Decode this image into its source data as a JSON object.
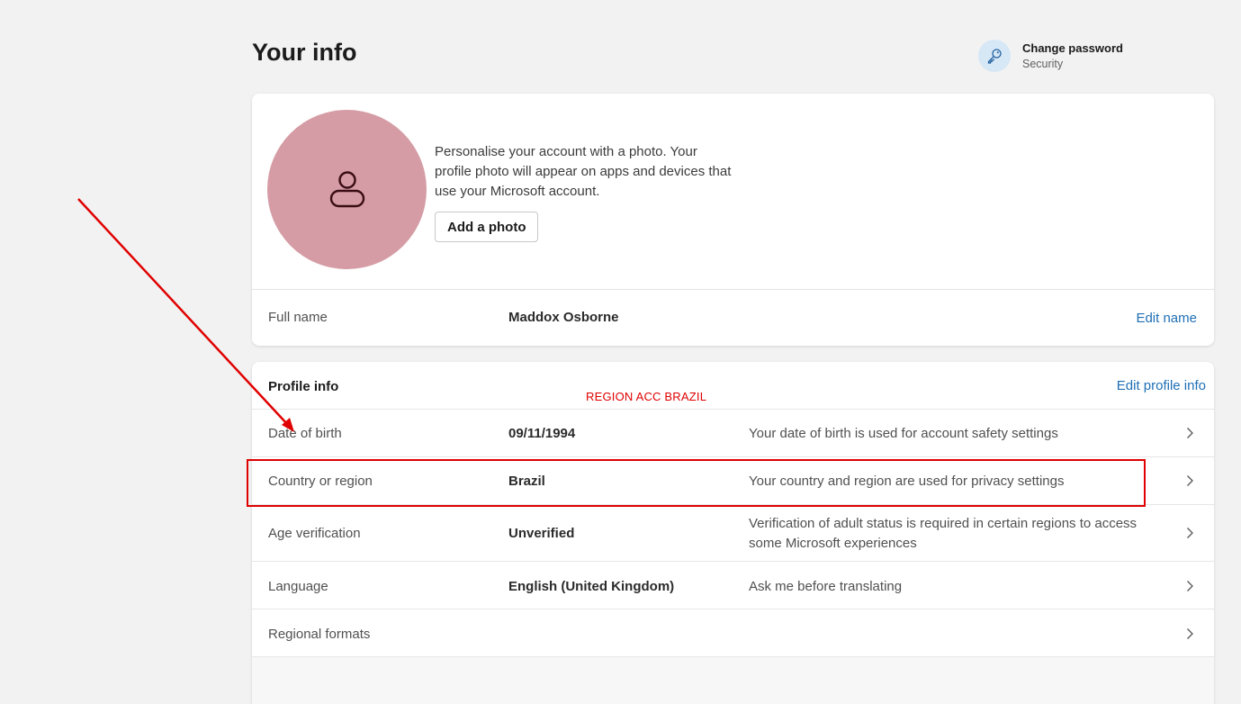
{
  "header": {
    "title": "Your info",
    "change_password": {
      "label": "Change password",
      "sublabel": "Security",
      "icon": "key-icon"
    }
  },
  "photo_card": {
    "description": "Personalise your account with a photo. Your profile photo will appear on apps and devices that use your Microsoft account.",
    "add_photo_label": "Add a photo",
    "avatar_color": "#d59ca5",
    "full_name_label": "Full name",
    "full_name_value": "Maddox Osborne",
    "edit_name_label": "Edit name"
  },
  "profile_info": {
    "title": "Profile info",
    "edit_label": "Edit profile info",
    "rows": [
      {
        "label": "Date of birth",
        "value": "09/11/1994",
        "desc": "Your date of birth is used for account safety settings"
      },
      {
        "label": "Country or region",
        "value": "Brazil",
        "desc": "Your country and region are used for privacy settings"
      },
      {
        "label": "Age verification",
        "value": "Unverified",
        "desc": "Verification of adult status is required in certain regions to access some Microsoft experiences"
      },
      {
        "label": "Language",
        "value": "English (United Kingdom)",
        "desc": "Ask me before translating"
      },
      {
        "label": "Regional formats",
        "value": "",
        "desc": ""
      }
    ]
  },
  "annotation": {
    "text": "REGION ACC BRAZIL",
    "color": "#e00000"
  },
  "colors": {
    "link": "#1f6fb5",
    "key_circle_bg": "#d6e7f6"
  }
}
